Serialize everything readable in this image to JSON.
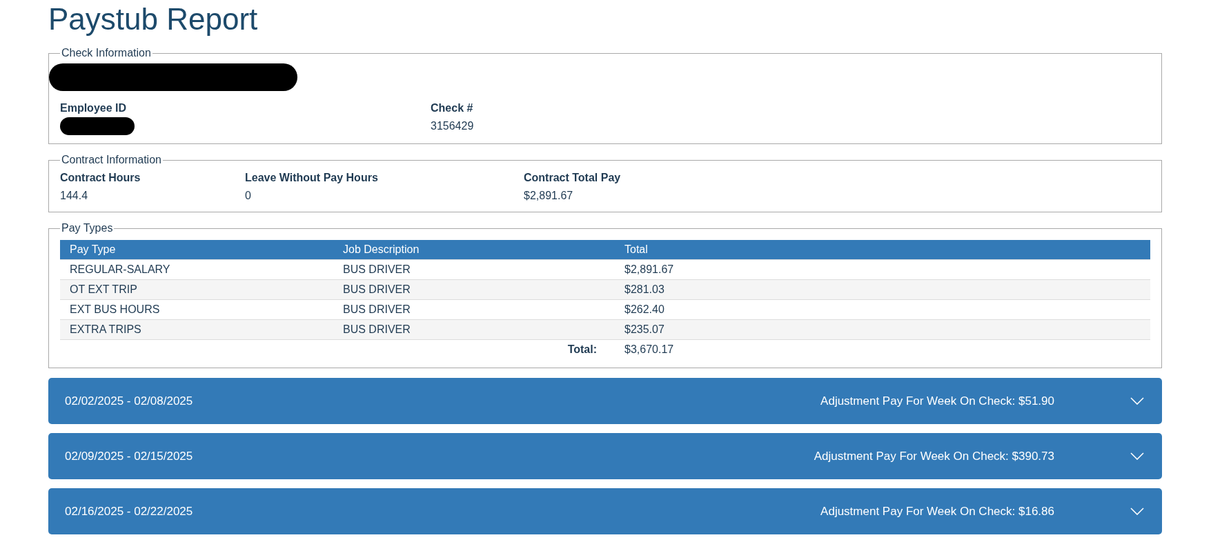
{
  "title": "Paystub Report",
  "check_information": {
    "legend": "Check Information",
    "redacted_name": true,
    "fields": [
      {
        "label": "Employee ID",
        "redacted": true
      },
      {
        "label": "Check #",
        "value": "3156429",
        "redacted": false
      }
    ]
  },
  "contract_information": {
    "legend": "Contract Information",
    "fields": [
      {
        "label": "Contract Hours",
        "value": "144.4"
      },
      {
        "label": "Leave Without Pay Hours",
        "value": "0"
      },
      {
        "label": "Contract Total Pay",
        "value": "$2,891.67"
      }
    ]
  },
  "pay_types": {
    "legend": "Pay Types",
    "columns": [
      "Pay Type",
      "Job Description",
      "Total"
    ],
    "rows": [
      [
        "REGULAR-SALARY",
        "BUS DRIVER",
        "$2,891.67"
      ],
      [
        "OT EXT TRIP",
        "BUS DRIVER",
        "$281.03"
      ],
      [
        "EXT BUS HOURS",
        "BUS DRIVER",
        "$262.40"
      ],
      [
        "EXTRA TRIPS",
        "BUS DRIVER",
        "$235.07"
      ]
    ],
    "total_label": "Total:",
    "total_value": "$3,670.17"
  },
  "weeks": [
    {
      "range": "02/02/2025 - 02/08/2025",
      "adjustment": "Adjustment Pay For Week On Check: $51.90",
      "expanded": false
    },
    {
      "range": "02/09/2025 - 02/15/2025",
      "adjustment": "Adjustment Pay For Week On Check: $390.73",
      "expanded": false
    },
    {
      "range": "02/16/2025 - 02/22/2025",
      "adjustment": "Adjustment Pay For Week On Check: $16.86",
      "expanded": false
    }
  ]
}
